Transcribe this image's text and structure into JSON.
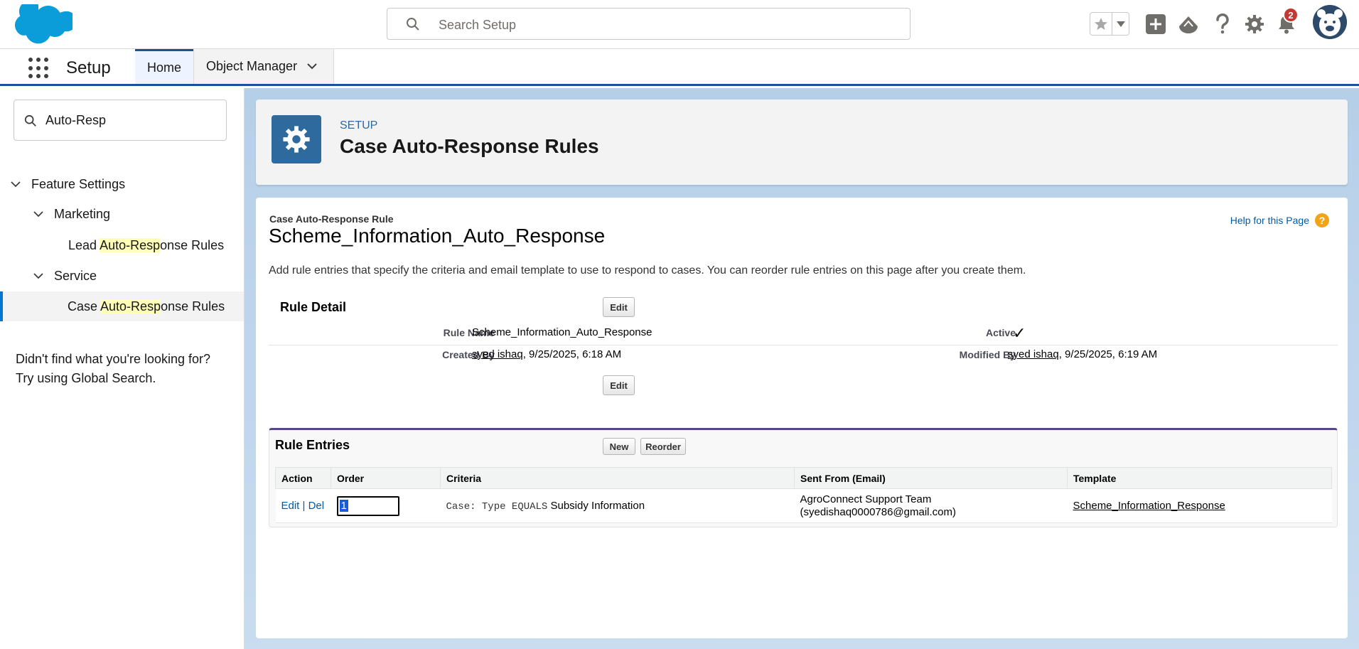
{
  "header": {
    "search_placeholder": "Search Setup",
    "notification_count": "2",
    "icons": [
      "favorites-star-icon",
      "chevron-down-icon",
      "add-icon",
      "trailhead-icon",
      "help-icon",
      "setup-gear-icon",
      "bell-icon",
      "avatar"
    ]
  },
  "context_bar": {
    "app_name": "Setup",
    "tabs": [
      {
        "label": "Home",
        "active": true
      },
      {
        "label": "Object Manager",
        "active": false
      }
    ]
  },
  "sidebar": {
    "quick_find_value": "Auto-Resp",
    "tree": {
      "feature_settings": "Feature Settings",
      "marketing": "Marketing",
      "lead_pre": "Lead ",
      "lead_hl": "Auto-Resp",
      "lead_post": "onse Rules",
      "service": "Service",
      "case_pre": "Case ",
      "case_hl": "Auto-Resp",
      "case_post": "onse Rules"
    },
    "hint_line1": "Didn't find what you're looking for?",
    "hint_line2": "Try using Global Search."
  },
  "page_header": {
    "breadcrumb": "SETUP",
    "title": "Case Auto-Response Rules"
  },
  "detail": {
    "subtitle": "Case Auto-Response Rule",
    "title": "Scheme_Information_Auto_Response",
    "help_link": "Help for this Page",
    "description": "Add rule entries that specify the criteria and email template to use to respond to cases. You can reorder rule entries on this page after you create them.",
    "section_title": "Rule Detail",
    "edit_label": "Edit",
    "rule_name_label": "Rule Name",
    "rule_name_value": "Scheme_Information_Auto_Response",
    "active_label": "Active",
    "active_value": "✓",
    "created_by_label": "Created By",
    "created_by_user": "syed ishaq",
    "created_by_date": ", 9/25/2025, 6:18 AM",
    "modified_by_label": "Modified By",
    "modified_by_user": "syed ishaq",
    "modified_by_date": ", 9/25/2025, 6:19 AM"
  },
  "rule_entries": {
    "title": "Rule Entries",
    "new_label": "New",
    "reorder_label": "Reorder",
    "columns": [
      "Action",
      "Order",
      "Criteria",
      "Sent From (Email)",
      "Template"
    ],
    "rows": [
      {
        "edit": "Edit",
        "sep": " | ",
        "del": "Del",
        "order": "1",
        "criteria_code": "Case: Type EQUALS",
        "criteria_value": " Subsidy Information",
        "sent_from_name": "AgroConnect Support Team",
        "sent_from_email": "(syedishaq0000786@gmail.com)",
        "template": "Scheme_Information_Response"
      }
    ]
  },
  "colors": {
    "brand_blue": "#1b5297",
    "link_blue": "#015ba7",
    "highlight": "#ffffb8",
    "section_border": "#56458c"
  }
}
